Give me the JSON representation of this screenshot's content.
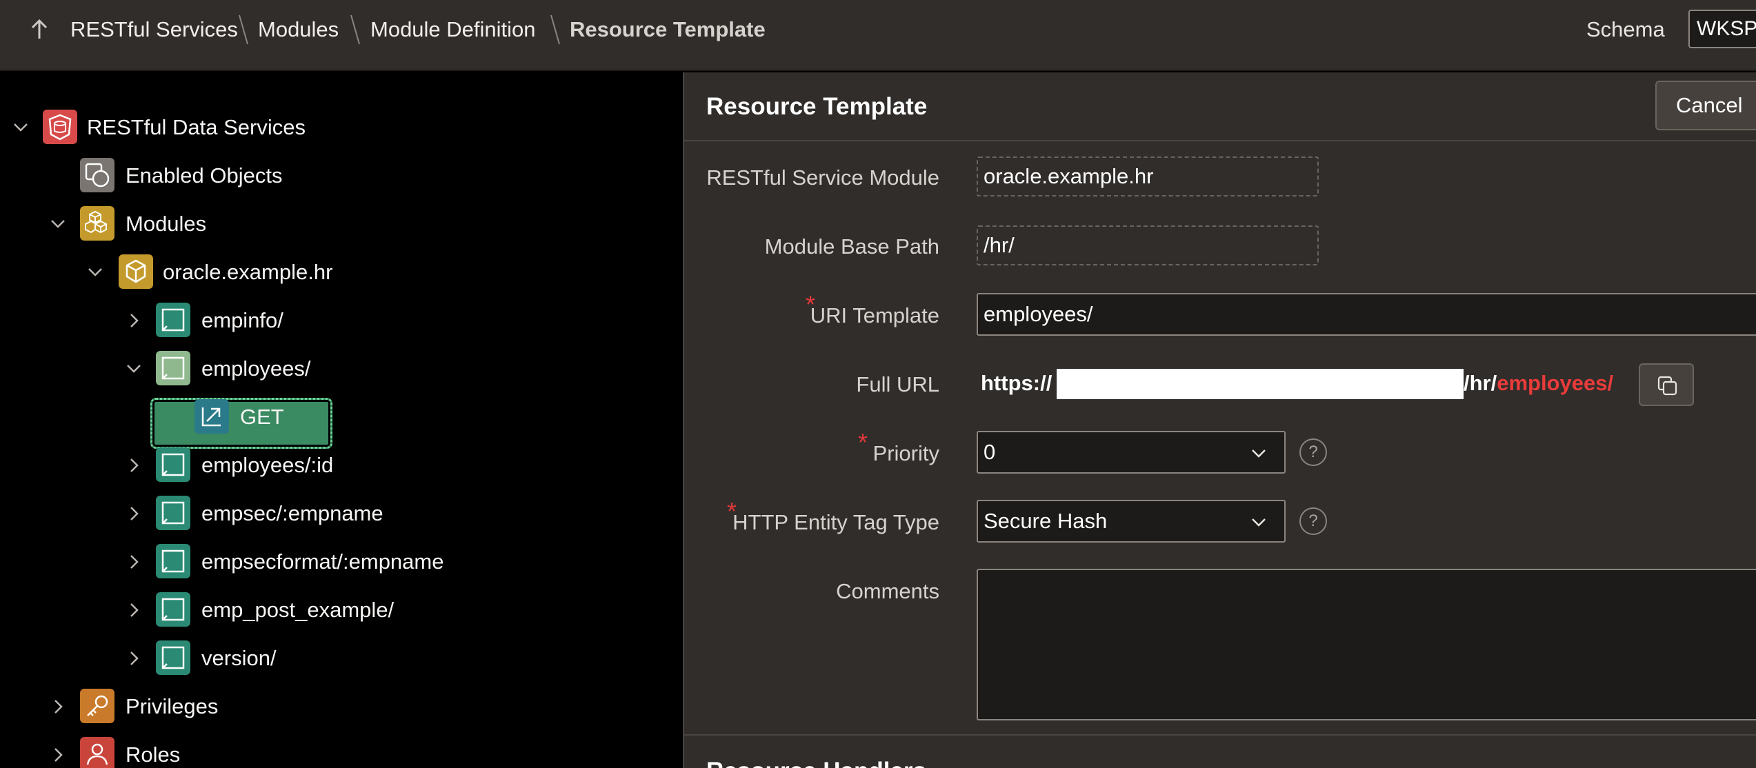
{
  "breadcrumb": {
    "items": [
      "RESTful Services",
      "Modules",
      "Module Definition"
    ],
    "current": "Resource Template"
  },
  "schema": {
    "label": "Schema",
    "value": "WKSP_"
  },
  "tree": {
    "root": "RESTful Data Services",
    "enabled_objects": "Enabled Objects",
    "modules": "Modules",
    "module_name": "oracle.example.hr",
    "templates": [
      "empinfo/",
      "employees/",
      "employees/:id",
      "empsec/:empname",
      "empsecformat/:empname",
      "emp_post_example/",
      "version/"
    ],
    "handler": "GET",
    "privileges": "Privileges",
    "roles": "Roles"
  },
  "form": {
    "title": "Resource Template",
    "cancel_label": "Cancel",
    "module_label": "RESTful Service Module",
    "module_value": "oracle.example.hr",
    "base_path_label": "Module Base Path",
    "base_path_value": "/hr/",
    "uri_label": "URI Template",
    "uri_value": "employees/",
    "full_url_label": "Full URL",
    "full_url_prefix": "https://",
    "full_url_path": "/hr/",
    "full_url_suffix": "employees/",
    "priority_label": "Priority",
    "priority_value": "0",
    "etag_label": "HTTP Entity Tag Type",
    "etag_value": "Secure Hash",
    "help_glyph": "?",
    "comments_label": "Comments",
    "comments_value": "",
    "next_section": "Resource Handlers",
    "required_mark": "*"
  },
  "colors": {
    "accent_green": "#3a8a62",
    "required_red": "#e0383b",
    "url_red": "#ea3b3b",
    "panel_bg": "#312d2a"
  }
}
